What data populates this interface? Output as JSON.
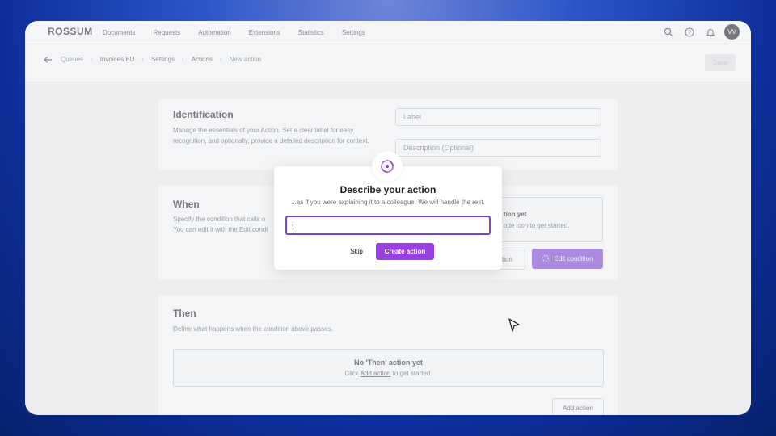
{
  "app": {
    "logo": "ROSSUM",
    "nav": [
      "Documents",
      "Requests",
      "Automation",
      "Extensions",
      "Statistics",
      "Settings"
    ],
    "icons": [
      "search-icon",
      "help-icon",
      "bell-icon"
    ],
    "avatar_initials": "VV"
  },
  "breadcrumb": {
    "items": [
      "Queues",
      "Invoices EU",
      "Settings",
      "Actions",
      "New action"
    ],
    "save_label": "Save"
  },
  "identification": {
    "title": "Identification",
    "description": "Manage the essentials of your Action. Set a clear label for easy recognition, and optionally, provide a detailed description for context.",
    "label_placeholder": "Label",
    "description_placeholder": "Description (Optional)"
  },
  "when": {
    "title": "When",
    "description_visible": "Specify the condition that calls o",
    "description_visible_2": "You can edit it with the Edit condi",
    "empty_title_visible": "tion yet",
    "empty_hint_visible": "ode icon to get started.",
    "secondary_button_visible": "ction",
    "edit_condition_label": "Edit condition"
  },
  "then": {
    "title": "Then",
    "description": "Define what happens when the condition above passes.",
    "empty_title": "No 'Then' action yet",
    "empty_hint_prefix": "Click",
    "empty_hint_link": "Add action",
    "empty_hint_suffix": "to get started.",
    "add_action_label": "Add action"
  },
  "modal": {
    "title": "Describe your action",
    "subtitle": "...as if you were explaining it to a colleague. We will handle the rest.",
    "input_value": "I",
    "skip_label": "Skip",
    "create_label": "Create action"
  },
  "colors": {
    "accent": "#7a3fd6",
    "create_button": "#9a3fe0"
  }
}
